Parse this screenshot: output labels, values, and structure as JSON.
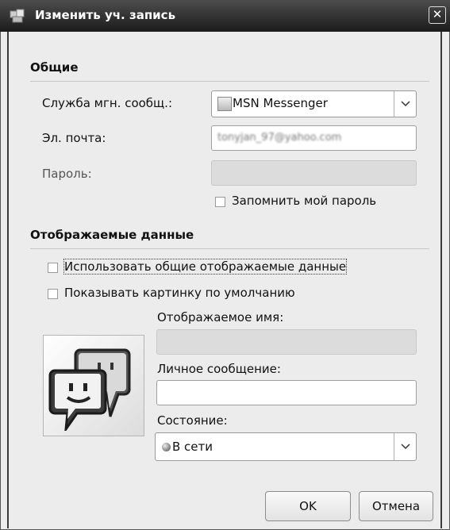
{
  "window": {
    "title": "Изменить уч. запись"
  },
  "sections": {
    "general": "Общие",
    "display": "Отображаемые данные"
  },
  "fields": {
    "service_label": "Служба мгн. сообщ.:",
    "service_value": "MSN Messenger",
    "email_label": "Эл. почта:",
    "email_value": "tonyjan_97@yahoo.com",
    "password_label": "Пароль:",
    "remember_password": "Запомнить мой пароль",
    "use_common_display": "Использовать общие отображаемые данные",
    "show_default_picture": "Показывать картинку по умолчанию",
    "display_name_label": "Отображаемое имя:",
    "personal_message_label": "Личное сообщение:",
    "status_label": "Состояние:",
    "status_value": "В сети"
  },
  "buttons": {
    "ok": "OK",
    "cancel": "Отмена"
  },
  "icons": {
    "title": "app-icon",
    "close": "close-icon",
    "service": "msn-icon",
    "status": "status-dot-icon",
    "avatar": "chat-bubbles-icon"
  }
}
